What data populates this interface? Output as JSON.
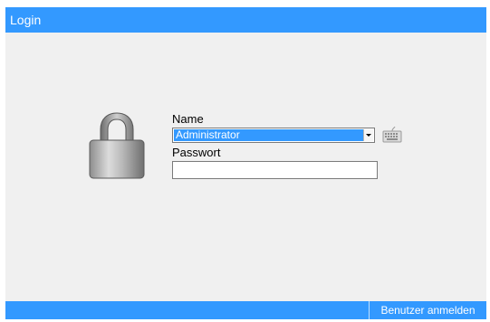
{
  "window": {
    "title": "Login"
  },
  "form": {
    "name_label": "Name",
    "name_value": "Administrator",
    "password_label": "Passwort",
    "password_value": ""
  },
  "footer": {
    "login_button": "Benutzer anmelden"
  },
  "icons": {
    "lock": "lock-icon",
    "keyboard": "keyboard-icon",
    "dropdown": "chevron-down-icon"
  },
  "colors": {
    "accent": "#3399ff",
    "background": "#f0f0f0"
  }
}
